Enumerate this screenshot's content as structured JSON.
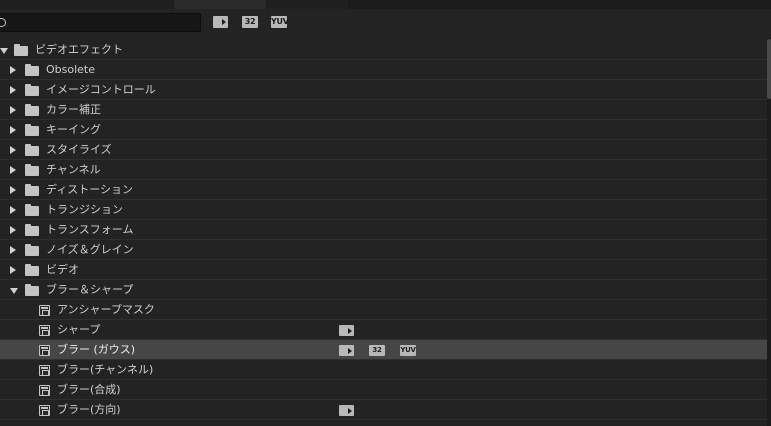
{
  "search": {
    "value": "",
    "placeholder": ""
  },
  "filters": {
    "accelerated": "",
    "bit32": "32",
    "yuv": "YUV"
  },
  "tree": {
    "root": "ビデオエフェクト",
    "folders": [
      "Obsolete",
      "イメージコントロール",
      "カラー補正",
      "キーイング",
      "スタイライズ",
      "チャンネル",
      "ディストーション",
      "トランジション",
      "トランスフォーム",
      "ノイズ＆グレイン",
      "ビデオ"
    ],
    "open_folder": "ブラー＆シャープ",
    "effects": [
      {
        "label": "アンシャープマスク",
        "accelerated": false,
        "bit32": false,
        "yuv": false
      },
      {
        "label": "シャープ",
        "accelerated": true,
        "bit32": false,
        "yuv": false
      },
      {
        "label": "ブラー (ガウス)",
        "accelerated": true,
        "bit32": true,
        "yuv": true,
        "selected": true
      },
      {
        "label": "ブラー(チャンネル)",
        "accelerated": false,
        "bit32": false,
        "yuv": false
      },
      {
        "label": "ブラー(合成)",
        "accelerated": false,
        "bit32": false,
        "yuv": false
      },
      {
        "label": "ブラー(方向)",
        "accelerated": true,
        "bit32": false,
        "yuv": false
      }
    ],
    "badge_text": {
      "bit32": "32",
      "yuv": "YUV"
    }
  },
  "icons": {
    "search": "search-icon",
    "folder": "folder-icon",
    "effect": "effect-icon",
    "expand": "triangle-right-icon",
    "collapse": "triangle-down-icon"
  },
  "colors": {
    "panel_bg": "#232323",
    "selected_row": "#464646",
    "icon": "#c4c4c4",
    "text": "#cfcfcf"
  }
}
